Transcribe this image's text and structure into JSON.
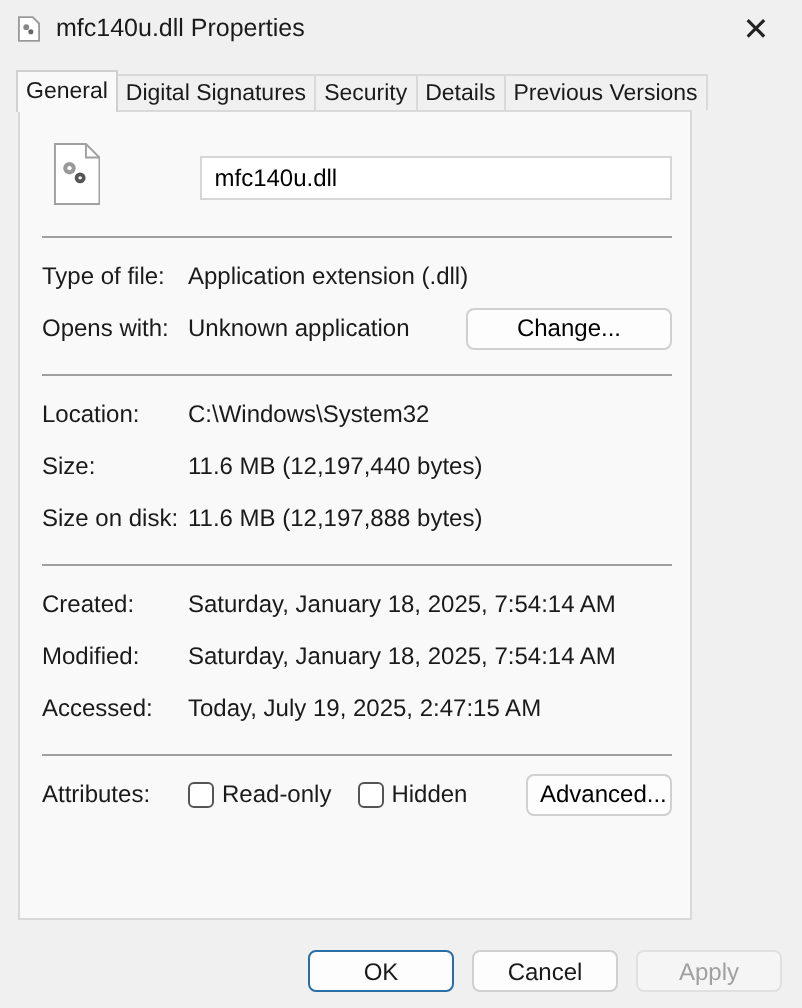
{
  "window": {
    "title": "mfc140u.dll Properties",
    "close": "✕"
  },
  "tabs": [
    {
      "label": "General",
      "selected": true
    },
    {
      "label": "Digital Signatures",
      "selected": false
    },
    {
      "label": "Security",
      "selected": false
    },
    {
      "label": "Details",
      "selected": false
    },
    {
      "label": "Previous Versions",
      "selected": false
    }
  ],
  "file_name": "mfc140u.dll",
  "sections": [
    {
      "rows": [
        {
          "label": "Type of file:",
          "value": "Application extension (.dll)"
        },
        {
          "label": "Opens with:",
          "value": "Unknown application",
          "button": "Change..."
        }
      ]
    },
    {
      "rows": [
        {
          "label": "Location:",
          "value": "C:\\Windows\\System32"
        },
        {
          "label": "Size:",
          "value": "11.6 MB (12,197,440 bytes)"
        },
        {
          "label": "Size on disk:",
          "value": "11.6 MB (12,197,888 bytes)"
        }
      ]
    },
    {
      "rows": [
        {
          "label": "Created:",
          "value": "Saturday, January 18, 2025, 7:54:14 AM"
        },
        {
          "label": "Modified:",
          "value": "Saturday, January 18, 2025, 7:54:14 AM"
        },
        {
          "label": "Accessed:",
          "value": "Today, July 19, 2025, 2:47:15 AM"
        }
      ]
    }
  ],
  "attributes": {
    "label": "Attributes:",
    "checkboxes": [
      {
        "label": "Read-only",
        "checked": false
      },
      {
        "label": "Hidden",
        "checked": false
      }
    ],
    "button": "Advanced..."
  },
  "buttons": [
    {
      "label": "OK",
      "kind": "default",
      "disabled": false
    },
    {
      "label": "Cancel",
      "kind": "normal",
      "disabled": false
    },
    {
      "label": "Apply",
      "kind": "normal",
      "disabled": true
    }
  ]
}
